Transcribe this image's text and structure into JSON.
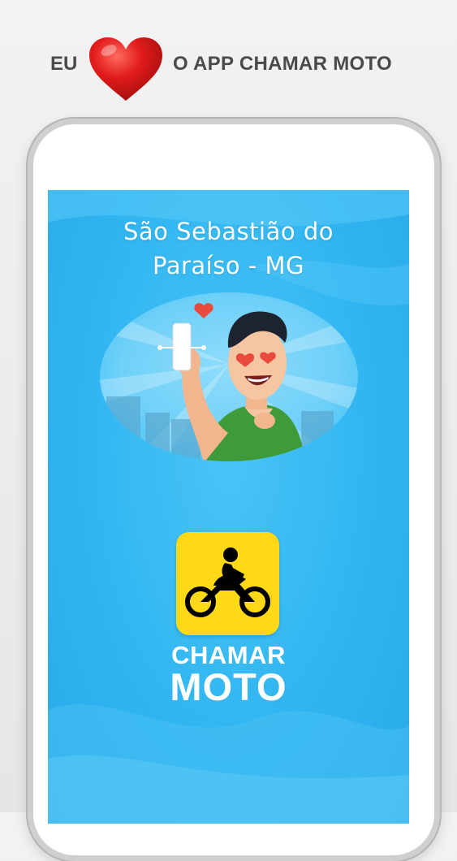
{
  "banner": {
    "left_text": "EU",
    "heart_icon": "heart-icon",
    "right_text": "O APP CHAMAR MOTO",
    "heart_color": "#e11b1b"
  },
  "screen": {
    "city_line1": "São Sebastião do",
    "city_line2": "Paraíso - MG",
    "background_color": "#2fb4f0"
  },
  "illustration": {
    "icon": "man-with-phone-icon",
    "heart_icon": "heart-icon"
  },
  "logo": {
    "icon": "motorcycle-rider-icon",
    "line1": "CHAMAR",
    "line2": "MOTO",
    "box_color": "#ffd816"
  }
}
